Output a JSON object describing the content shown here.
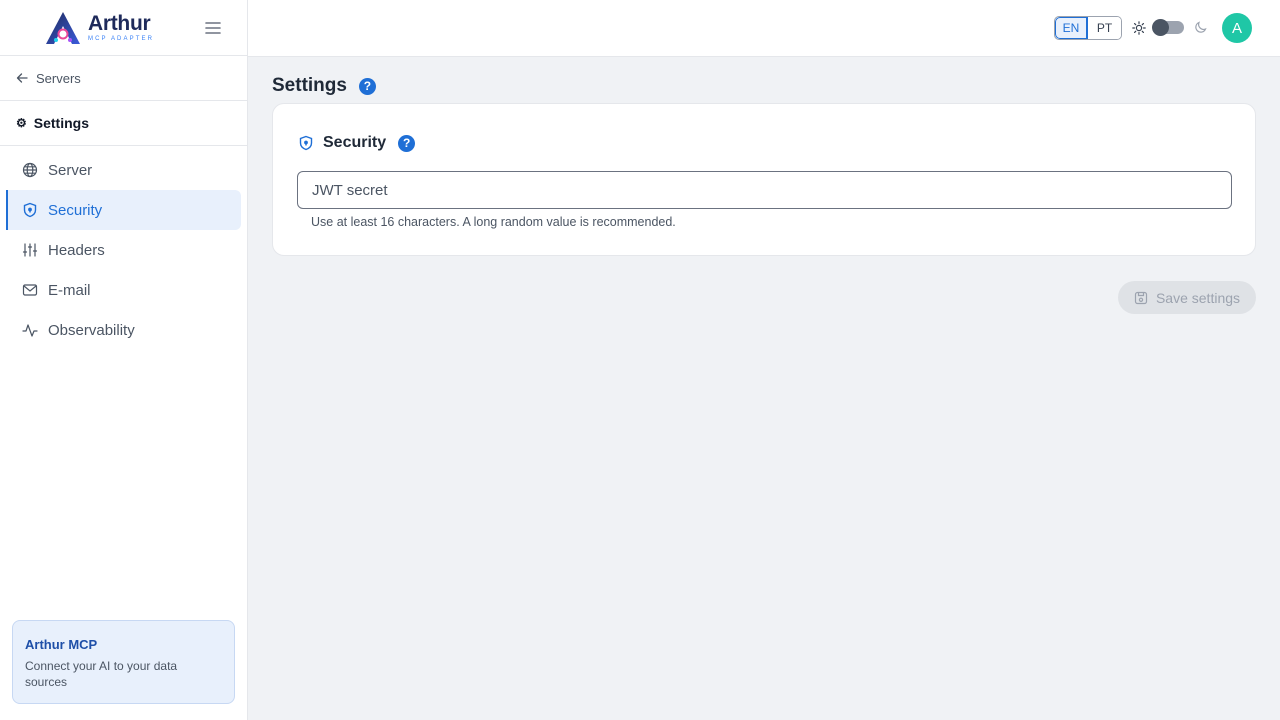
{
  "brand": {
    "name": "Arthur",
    "subtitle": "MCP ADAPTER"
  },
  "sidebar": {
    "back_label": "Servers",
    "section_title": "Settings",
    "items": [
      {
        "label": "Server",
        "icon": "globe-icon"
      },
      {
        "label": "Security",
        "icon": "shield-icon",
        "active": true
      },
      {
        "label": "Headers",
        "icon": "sliders-icon"
      },
      {
        "label": "E-mail",
        "icon": "mail-icon"
      },
      {
        "label": "Observability",
        "icon": "activity-icon"
      }
    ],
    "promo": {
      "title": "Arthur MCP",
      "text": "Connect your AI to your data sources"
    }
  },
  "header": {
    "languages": [
      "EN",
      "PT"
    ],
    "selected_language": "EN",
    "theme": "light",
    "avatar_initial": "A"
  },
  "main": {
    "title": "Settings",
    "card": {
      "title": "Security",
      "jwt_field": {
        "placeholder": "JWT secret",
        "value": ""
      },
      "hint": "Use at least 16 characters. A long random value is recommended."
    },
    "save_label": "Save settings"
  },
  "colors": {
    "accent": "#1f6fd6",
    "avatar": "#1fc7a6",
    "brand_dark": "#1e2a5a"
  }
}
